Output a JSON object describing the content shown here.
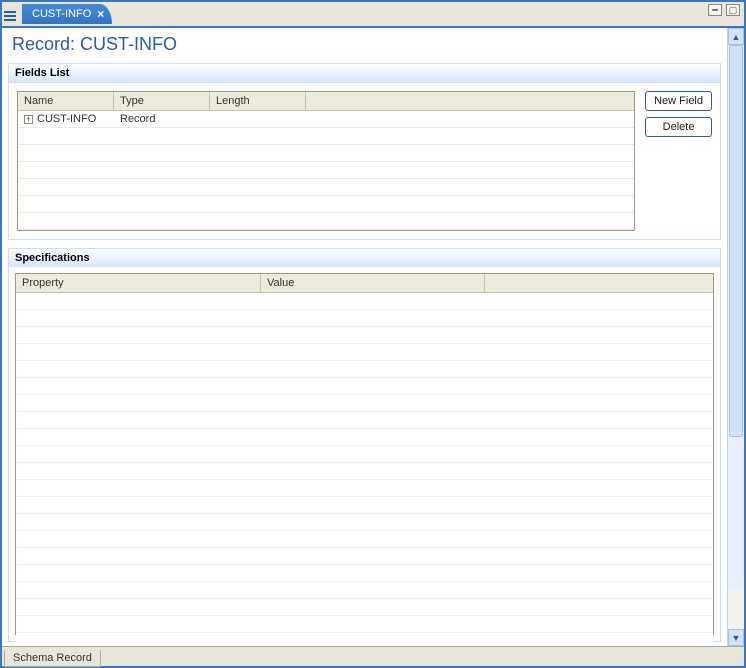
{
  "tab": {
    "title": "CUST-INFO"
  },
  "page": {
    "title": "Record: CUST-INFO"
  },
  "fields_section": {
    "title": "Fields List",
    "columns": [
      "Name",
      "Type",
      "Length",
      ""
    ],
    "rows": [
      {
        "name": "CUST-INFO",
        "type": "Record",
        "length": "",
        "extra": ""
      }
    ],
    "buttons": {
      "new_field": "New Field",
      "delete": "Delete"
    }
  },
  "specs_section": {
    "title": "Specifications",
    "columns": [
      "Property",
      "Value",
      ""
    ],
    "rows": []
  },
  "bottom_tab": {
    "label": "Schema Record"
  }
}
